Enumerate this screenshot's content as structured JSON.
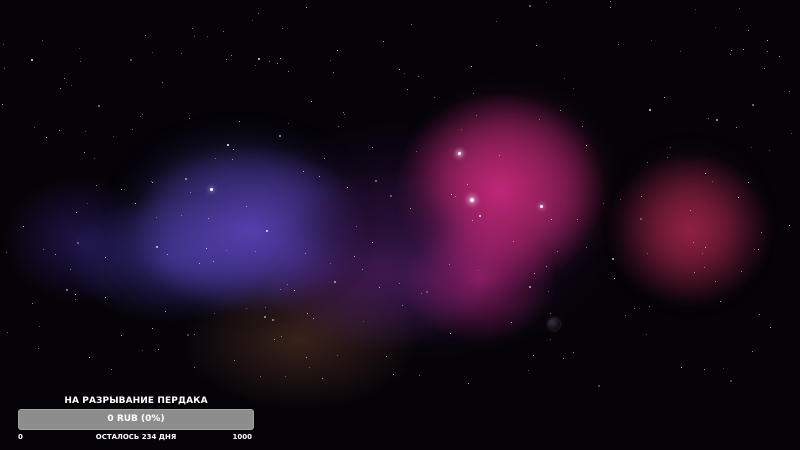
{
  "goal_widget": {
    "title": "НА РАЗРЫВАНИЕ ПЕРДАКА",
    "amount_text": "0 RUB (0%)",
    "progress_fraction": 0,
    "min_label": "0",
    "days_left": "ОСТАЛОСЬ 234 ДНЯ",
    "max_label": "1000"
  },
  "colors": {
    "bar_background": "#8d8d8d",
    "bar_fill": "#d94a8c",
    "text": "#ffffff"
  },
  "background": {
    "type": "space-nebula-image"
  }
}
